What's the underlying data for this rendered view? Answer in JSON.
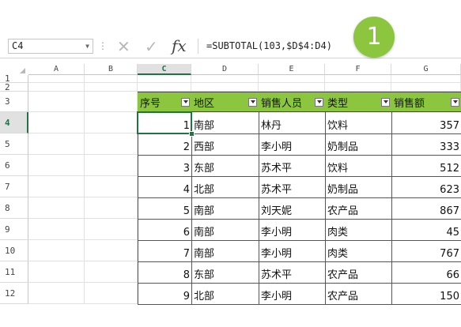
{
  "formula_bar": {
    "name_box": "C4",
    "dropdown_glyph": "▼",
    "separator": "⋮",
    "cancel_glyph": "✕",
    "enter_glyph": "✓",
    "fx_label": "fx",
    "formula": "=SUBTOTAL(103,$D$4:D4)"
  },
  "badge": {
    "number": "1"
  },
  "columns": [
    "A",
    "B",
    "C",
    "D",
    "E",
    "F",
    "G"
  ],
  "rows": [
    "1",
    "2",
    "3",
    "4",
    "5",
    "6",
    "7",
    "8",
    "9",
    "10",
    "11",
    "12"
  ],
  "table": {
    "headers": [
      "序号",
      "地区",
      "销售人员",
      "类型",
      "销售额"
    ],
    "rows": [
      {
        "no": "1",
        "region": "南部",
        "person": "林丹",
        "type": "饮料",
        "sales": "357"
      },
      {
        "no": "2",
        "region": "西部",
        "person": "李小明",
        "type": "奶制品",
        "sales": "333"
      },
      {
        "no": "3",
        "region": "东部",
        "person": "苏术平",
        "type": "饮料",
        "sales": "512"
      },
      {
        "no": "4",
        "region": "北部",
        "person": "苏术平",
        "type": "奶制品",
        "sales": "623"
      },
      {
        "no": "5",
        "region": "南部",
        "person": "刘天妮",
        "type": "农产品",
        "sales": "867"
      },
      {
        "no": "6",
        "region": "南部",
        "person": "李小明",
        "type": "肉类",
        "sales": "45"
      },
      {
        "no": "7",
        "region": "南部",
        "person": "李小明",
        "type": "肉类",
        "sales": "767"
      },
      {
        "no": "8",
        "region": "东部",
        "person": "苏术平",
        "type": "农产品",
        "sales": "66"
      },
      {
        "no": "9",
        "region": "北部",
        "person": "李小明",
        "type": "农产品",
        "sales": "150"
      }
    ]
  },
  "colors": {
    "accent_green": "#8cc63f",
    "excel_green": "#217346"
  }
}
